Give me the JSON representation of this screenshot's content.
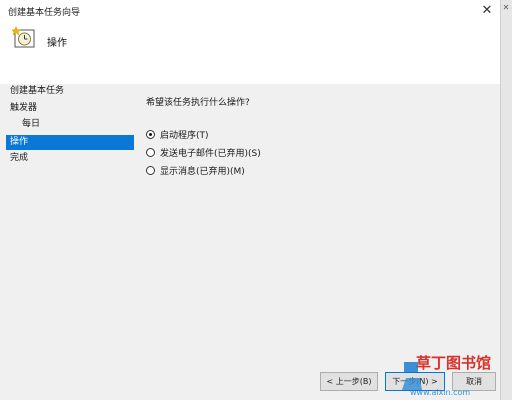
{
  "window": {
    "title": "创建基本任务向导",
    "close_glyph": "✕"
  },
  "header": {
    "icon": "task-clock-icon",
    "title": "操作"
  },
  "sidebar": {
    "items": [
      {
        "label": "创建基本任务"
      },
      {
        "label": "触发器"
      },
      {
        "label": "每日"
      },
      {
        "label": "操作"
      },
      {
        "label": "完成"
      }
    ],
    "selected_index": 3
  },
  "main": {
    "question": "希望该任务执行什么操作?",
    "options": [
      {
        "label": "启动程序(T)",
        "checked": true
      },
      {
        "label": "发送电子邮件(已弃用)(S)",
        "checked": false
      },
      {
        "label": "显示消息(已弃用)(M)",
        "checked": false
      }
    ]
  },
  "buttons": {
    "back": "< 上一步(B)",
    "next": "下一步(N) >",
    "cancel": "取消"
  },
  "watermark": {
    "line1": "草丁图书馆",
    "line2": "www.aixin.com"
  },
  "colors": {
    "selected_bg": "#0a78d7",
    "primary_border": "#0078d7",
    "watermark_red": "#d9322a",
    "watermark_blue": "#3b8fd6"
  }
}
